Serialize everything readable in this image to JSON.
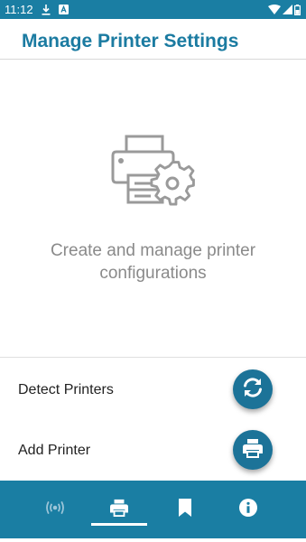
{
  "status_bar": {
    "time": "11:12",
    "icons": [
      "download-icon",
      "notification-a-icon",
      "wifi-icon",
      "signal-icon",
      "battery-icon"
    ]
  },
  "header": {
    "title": "Manage Printer Settings"
  },
  "empty_state": {
    "icon": "printer-settings-icon",
    "message": "Create and manage printer configurations"
  },
  "actions": [
    {
      "label": "Detect Printers",
      "icon": "refresh-icon"
    },
    {
      "label": "Add Printer",
      "icon": "printer-icon"
    }
  ],
  "bottom_nav": {
    "items": [
      {
        "icon": "wireless-icon",
        "selected": false
      },
      {
        "icon": "printer-icon",
        "selected": true
      },
      {
        "icon": "bookmark-icon",
        "selected": false
      },
      {
        "icon": "info-icon",
        "selected": false
      }
    ]
  },
  "colors": {
    "primary": "#1a7ea3",
    "title": "#1b7ba1",
    "fab": "#1c7398",
    "muted_text": "#8a8a8a"
  }
}
